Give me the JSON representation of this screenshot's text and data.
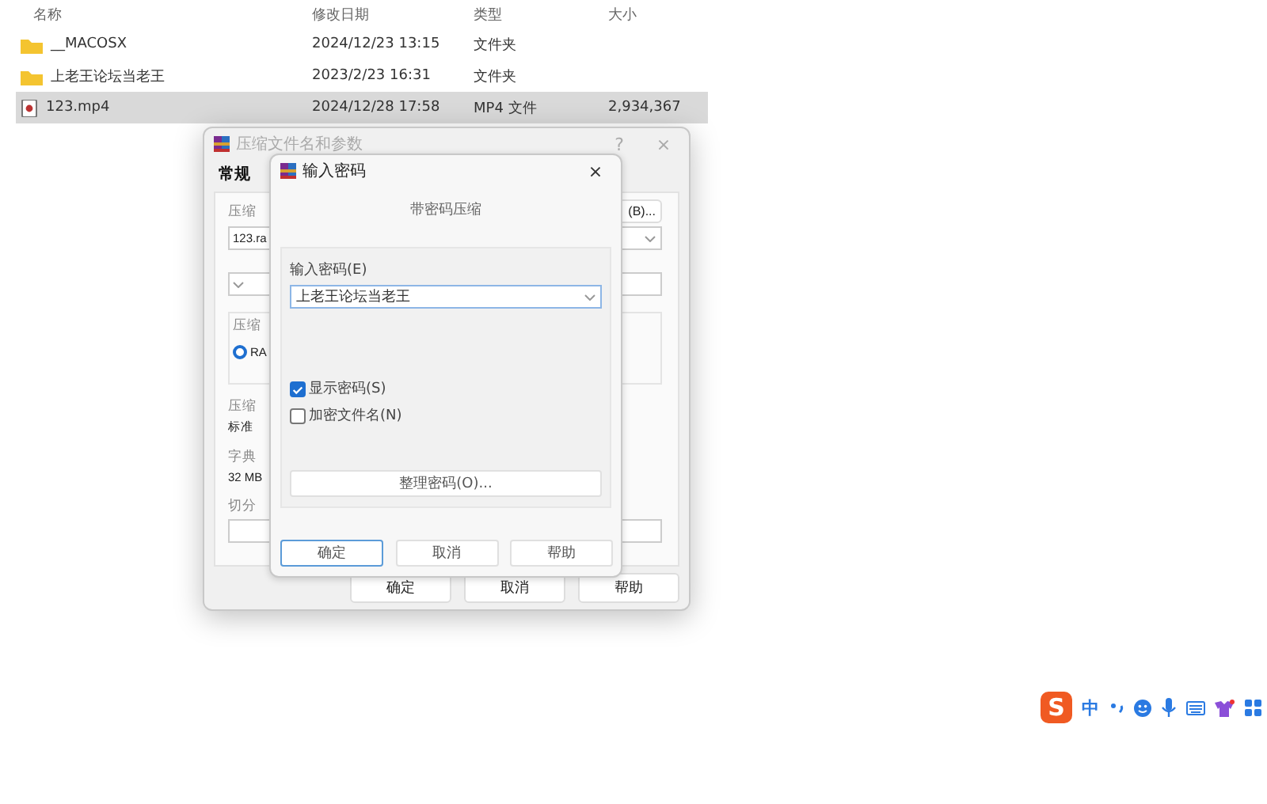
{
  "explorer": {
    "columns": [
      "名称",
      "修改日期",
      "类型",
      "大小"
    ],
    "rows": [
      {
        "kind": "folder",
        "name": "__MACOSX",
        "date": "2024/12/23 13:15",
        "type": "文件夹",
        "selected": false
      },
      {
        "kind": "folder",
        "name": "上老王论坛当老王",
        "date": "2023/2/23 16:31",
        "type": "文件夹",
        "selected": false
      },
      {
        "kind": "video",
        "name": "123.mp4",
        "date": "2024/12/28 17:58",
        "type": "MP4 文件",
        "size": "2,934,367",
        "selected": true
      }
    ]
  },
  "archive_dialog": {
    "title": "压缩文件名和参数",
    "help": "?",
    "close": "×",
    "tabs": [
      {
        "label": "常规",
        "selected": true
      }
    ],
    "name_label": "压缩",
    "browse_button": "(B)...",
    "archive_name": "123.ra",
    "format_label": "压缩",
    "format_option": {
      "label": "RA",
      "selected": true
    },
    "method_label": "压缩",
    "method_value": "标准",
    "dict_label": "字典",
    "dict_value": "32 MB",
    "split_label": "切分",
    "buttons": [
      "确定",
      "取消",
      "帮助"
    ]
  },
  "password_dialog": {
    "title": "输入密码",
    "close": "×",
    "heading": "带密码压缩",
    "password_label": "输入密码(E)",
    "password_value": "上老王论坛当老王",
    "options": [
      {
        "label": "显示密码(S)",
        "checked": true
      },
      {
        "label": "加密文件名(N)",
        "checked": false
      }
    ],
    "organize_button": "整理密码(O)...",
    "buttons": [
      {
        "label": "确定",
        "selected": true
      },
      {
        "label": "取消",
        "selected": false
      },
      {
        "label": "帮助",
        "selected": false
      }
    ]
  },
  "ime_bar": {
    "logo": "S",
    "mode": "中"
  }
}
